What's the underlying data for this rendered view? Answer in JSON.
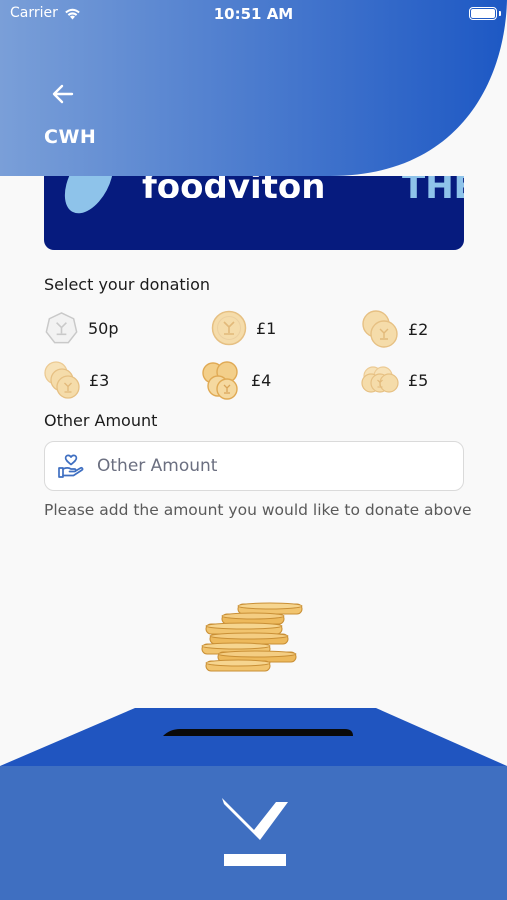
{
  "status_bar": {
    "carrier": "Carrier",
    "time": "10:51 AM"
  },
  "header": {
    "title": "CWH",
    "back_icon": "arrow-left-icon"
  },
  "banner": {
    "text_main": "foodviton",
    "text_accent": "THE UK"
  },
  "donation": {
    "section_label": "Select your donation",
    "options": [
      {
        "label": "50p",
        "icon": "coin-50p-icon"
      },
      {
        "label": "£1",
        "icon": "coin-single-icon"
      },
      {
        "label": "£2",
        "icon": "coin-double-icon"
      },
      {
        "label": "£3",
        "icon": "coin-triple-icon"
      },
      {
        "label": "£4",
        "icon": "coin-quad-icon"
      },
      {
        "label": "£5",
        "icon": "coin-stack-icon"
      }
    ]
  },
  "other_amount": {
    "label": "Other Amount",
    "placeholder": "Other Amount",
    "value": "",
    "hint": "Please add the amount you would like to donate above"
  },
  "colors": {
    "header_gradient_start": "#7a9fd8",
    "header_gradient_end": "#1d58c4",
    "banner_bg": "#061b7e",
    "box_top": "#2055c0",
    "box_front": "#3f6fc1",
    "coin_fill": "#f5d9a6",
    "coin_stroke": "#e3b56e"
  }
}
